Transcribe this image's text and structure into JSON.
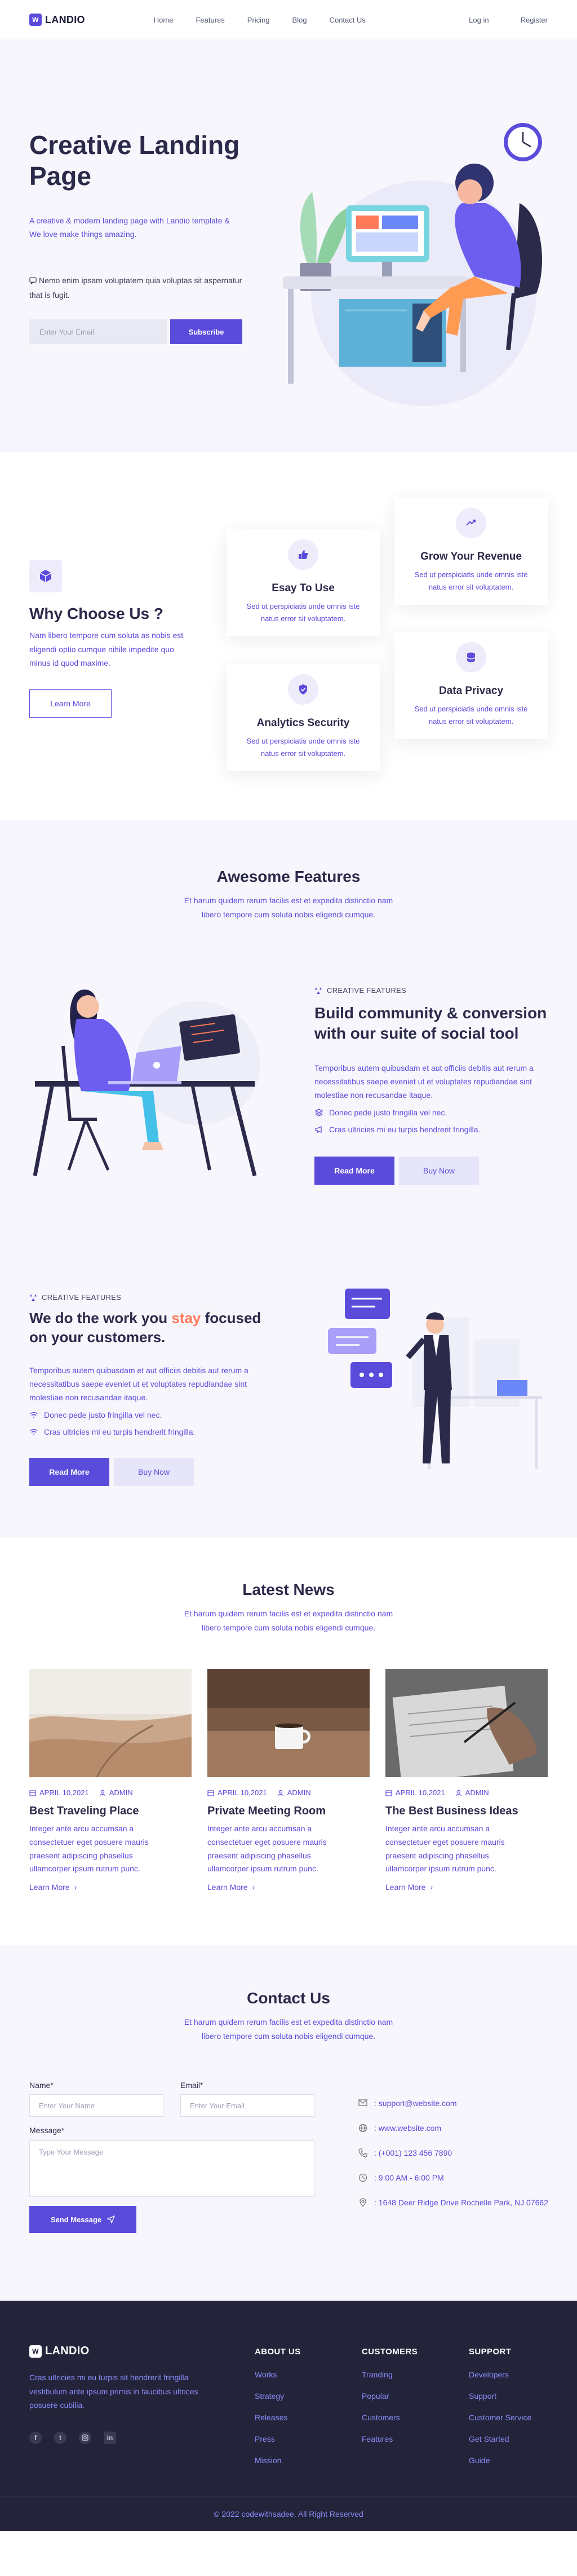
{
  "brand": {
    "logo_text": "LANDIO",
    "logo_glyph": "W",
    "accent": "#5b4bdb",
    "dark": "#23233a"
  },
  "nav": {
    "links": [
      "Home",
      "Features",
      "Pricing",
      "Blog",
      "Contact Us"
    ],
    "login": "Log in",
    "register": "Register"
  },
  "hero": {
    "title": "Creative Landing Page",
    "description": "A creative & modern landing page with Landio template & We love make things amazing.",
    "note": "Nemo enim ipsam voluptatem quia voluptas sit aspernatur that is fugit.",
    "email_placeholder": "Enter Your Email",
    "subscribe_label": "Subscribe"
  },
  "why": {
    "title": "Why Choose Us ?",
    "description": "Nam libero tempore cum soluta as nobis est eligendi optio cumque nihile impedite quo minus id quod maxime.",
    "button": "Learn More",
    "cards": [
      {
        "icon": "thumbs-up-icon",
        "title": "Esay To Use",
        "desc": "Sed ut perspiciatis unde omnis iste natus error sit voluptatem."
      },
      {
        "icon": "trend-up-icon",
        "title": "Grow Your Revenue",
        "desc": "Sed ut perspiciatis unde omnis iste natus error sit voluptatem."
      },
      {
        "icon": "shield-check-icon",
        "title": "Analytics Security",
        "desc": "Sed ut perspiciatis unde omnis iste natus error sit voluptatem."
      },
      {
        "icon": "database-icon",
        "title": "Data Privacy",
        "desc": "Sed ut perspiciatis unde omnis iste natus error sit voluptatem."
      }
    ]
  },
  "features": {
    "title": "Awesome Features",
    "subtitle": "Et harum quidem rerum facilis est et expedita distinctio nam libero tempore cum soluta nobis eligendi cumque.",
    "block1": {
      "tag": "CREATIVE FEATURES",
      "heading": "Build community & conversion with our suite of social tool",
      "text": "Temporibus autem quibusdam et aut officiis debitis aut rerum a necessitatibus saepe eveniet ut et voluptates repudiandae sint molestiae non recusandae itaque.",
      "items": [
        "Donec pede justo fringilla vel nec.",
        "Cras ultricies mi eu turpis hendrerit fringilla."
      ],
      "btn_read": "Read More",
      "btn_buy": "Buy Now"
    },
    "block2": {
      "tag": "CREATIVE FEATURES",
      "heading_plain": "We do the work you",
      "heading_accent": "stay",
      "heading_rest": "focused on your customers.",
      "text": "Temporibus autem quibusdam et aut officiis debitis aut rerum a necessitatibus saepe eveniet ut et voluptates repudiandae sint molestiae non recusandae itaque.",
      "items": [
        "Donec pede justo fringilla vel nec.",
        "Cras ultricies mi eu turpis hendrerit fringilla."
      ],
      "btn_read": "Read More",
      "btn_buy": "Buy Now"
    }
  },
  "news": {
    "title": "Latest News",
    "subtitle": "Et harum quidem rerum facilis est et expedita distinctio nam libero tempore cum soluta nobis eligendi cumque.",
    "posts": [
      {
        "date": "APRIL 10,2021",
        "author": "ADMIN",
        "title": "Best Traveling Place",
        "desc": "Integer ante arcu accumsan a consectetuer eget posuere mauris praesent adipiscing phasellus ullamcorper ipsum rutrum punc.",
        "more": "Learn More"
      },
      {
        "date": "APRIL 10,2021",
        "author": "ADMIN",
        "title": "Private Meeting Room",
        "desc": "Integer ante arcu accumsan a consectetuer eget posuere mauris praesent adipiscing phasellus ullamcorper ipsum rutrum punc.",
        "more": "Learn More"
      },
      {
        "date": "APRIL 10,2021",
        "author": "ADMIN",
        "title": "The Best Business Ideas",
        "desc": "Integer ante arcu accumsan a consectetuer eget posuere mauris praesent adipiscing phasellus ullamcorper ipsum rutrum punc.",
        "more": "Learn More"
      }
    ]
  },
  "contact": {
    "title": "Contact Us",
    "subtitle": "Et harum quidem rerum facilis est et expedita distinctio nam libero tempore cum soluta nobis eligendi cumque.",
    "name_label": "Name*",
    "name_placeholder": "Enter Your Name",
    "email_label": "Email*",
    "email_placeholder": "Enter Your Email",
    "message_label": "Message*",
    "message_placeholder": "Type Your Message",
    "send_label": "Send Message",
    "info": {
      "email": ": support@website.com",
      "website": ": www.website.com",
      "phone": ": (+001) 123 456 7890",
      "hours": ": 9:00 AM - 6:00 PM",
      "address": ": 1648 Deer Ridge Drive Rochelle Park, NJ 07662"
    }
  },
  "footer": {
    "logo_text": "LANDIO",
    "description": "Cras ultricies mi eu turpis sit hendrerit fringilla vestibulum ante ipsum primis in faucibus ultrices posuere cubilia.",
    "socials": [
      "facebook-icon",
      "twitter-icon",
      "instagram-icon",
      "linkedin-icon"
    ],
    "columns": [
      {
        "heading": "ABOUT US",
        "items": [
          "Works",
          "Strategy",
          "Releases",
          "Press",
          "Mission"
        ]
      },
      {
        "heading": "CUSTOMERS",
        "items": [
          "Tranding",
          "Popular",
          "Customers",
          "Features"
        ]
      },
      {
        "heading": "SUPPORT",
        "items": [
          "Developers",
          "Support",
          "Customer Service",
          "Get Started",
          "Guide"
        ]
      }
    ],
    "copyright": "© 2022 codewithsadee. All Right Reserved"
  }
}
